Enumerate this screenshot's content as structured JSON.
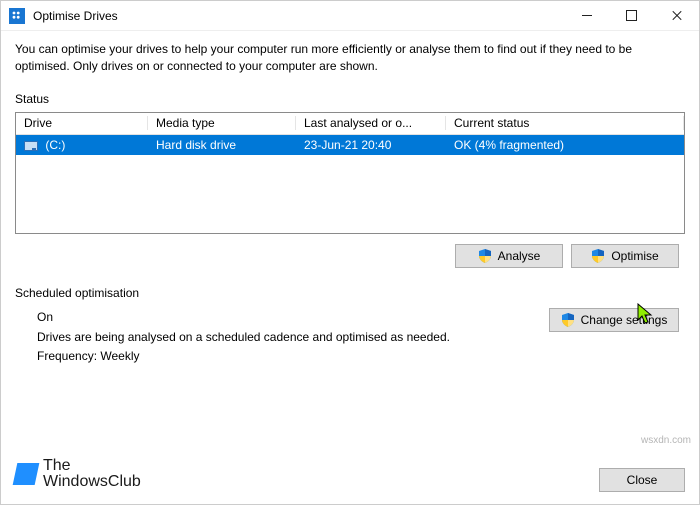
{
  "window": {
    "title": "Optimise Drives"
  },
  "description": "You can optimise your drives to help your computer run more efficiently or analyse them to find out if they need to be optimised. Only drives on or connected to your computer are shown.",
  "status": {
    "label": "Status",
    "columns": {
      "drive": "Drive",
      "media": "Media type",
      "last": "Last analysed or o...",
      "status": "Current status"
    },
    "rows": [
      {
        "drive": "(C:)",
        "media": "Hard disk drive",
        "last": "23-Jun-21 20:40",
        "status": "OK (4% fragmented)"
      }
    ]
  },
  "buttons": {
    "analyse": "Analyse",
    "optimise": "Optimise",
    "change_settings": "Change settings",
    "close": "Close"
  },
  "scheduled": {
    "label": "Scheduled optimisation",
    "state": "On",
    "detail": "Drives are being analysed on a scheduled cadence and optimised as needed.",
    "frequency": "Frequency: Weekly"
  },
  "watermark": {
    "line1": "The",
    "line2": "WindowsClub",
    "source": "wsxdn.com"
  }
}
